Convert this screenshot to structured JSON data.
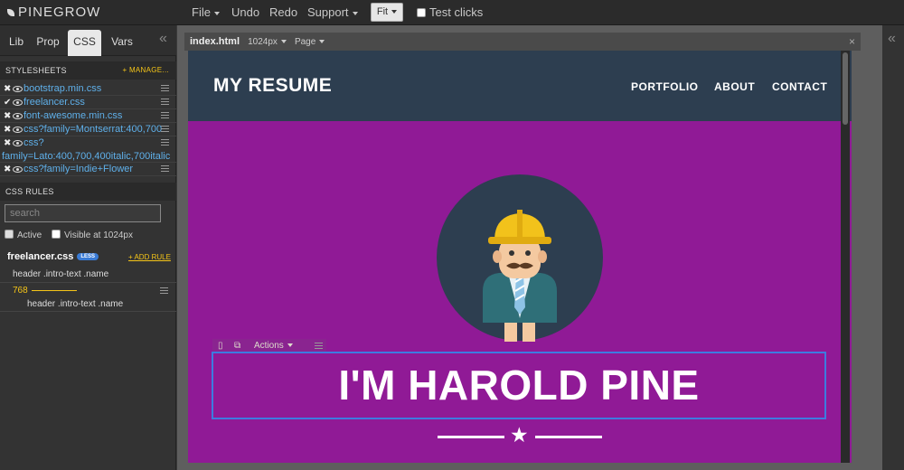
{
  "app": {
    "logo_text": "PINEGROW",
    "menu": {
      "file": "File",
      "undo": "Undo",
      "redo": "Redo",
      "support": "Support",
      "fit": "Fit",
      "test_clicks": "Test clicks"
    }
  },
  "left_panel": {
    "tabs": [
      "Lib",
      "Prop",
      "CSS",
      "Vars"
    ],
    "active_tab": "CSS",
    "stylesheets_title": "STYLESHEETS",
    "manage_label": "+ MANAGE...",
    "stylesheets": [
      {
        "mark": "✖",
        "name": "bootstrap.min.css"
      },
      {
        "mark": "✔",
        "name": "freelancer.css"
      },
      {
        "mark": "✖",
        "name": "font-awesome.min.css"
      },
      {
        "mark": "✖",
        "name": "css?family=Montserrat:400,700"
      },
      {
        "mark": "✖",
        "name": "css?",
        "cont": "family=Lato:400,700,400italic,700italic"
      },
      {
        "mark": "✖",
        "name": "css?family=Indie+Flower"
      }
    ],
    "css_rules_title": "CSS RULES",
    "search_placeholder": "search",
    "active_label": "Active",
    "visible_label": "Visible at 1024px",
    "file_label": "freelancer.css",
    "less_badge": "LESS",
    "add_rule_label": "+ ADD RULE",
    "rules": [
      {
        "selector": "header .intro-text .name"
      },
      {
        "media": "768",
        "selector": "header .intro-text .name"
      }
    ]
  },
  "page": {
    "file_tab": "index.html",
    "width_label": "1024px",
    "page_menu": "Page",
    "close_label": "×"
  },
  "site": {
    "brand": "MY RESUME",
    "nav": [
      "PORTFOLIO",
      "ABOUT",
      "CONTACT"
    ],
    "heading": "I'M HAROLD PINE",
    "actions_label": "Actions",
    "colors": {
      "nav_bg": "#2d3e50",
      "hero_bg": "#901a96",
      "selection": "#3d7be0"
    }
  }
}
